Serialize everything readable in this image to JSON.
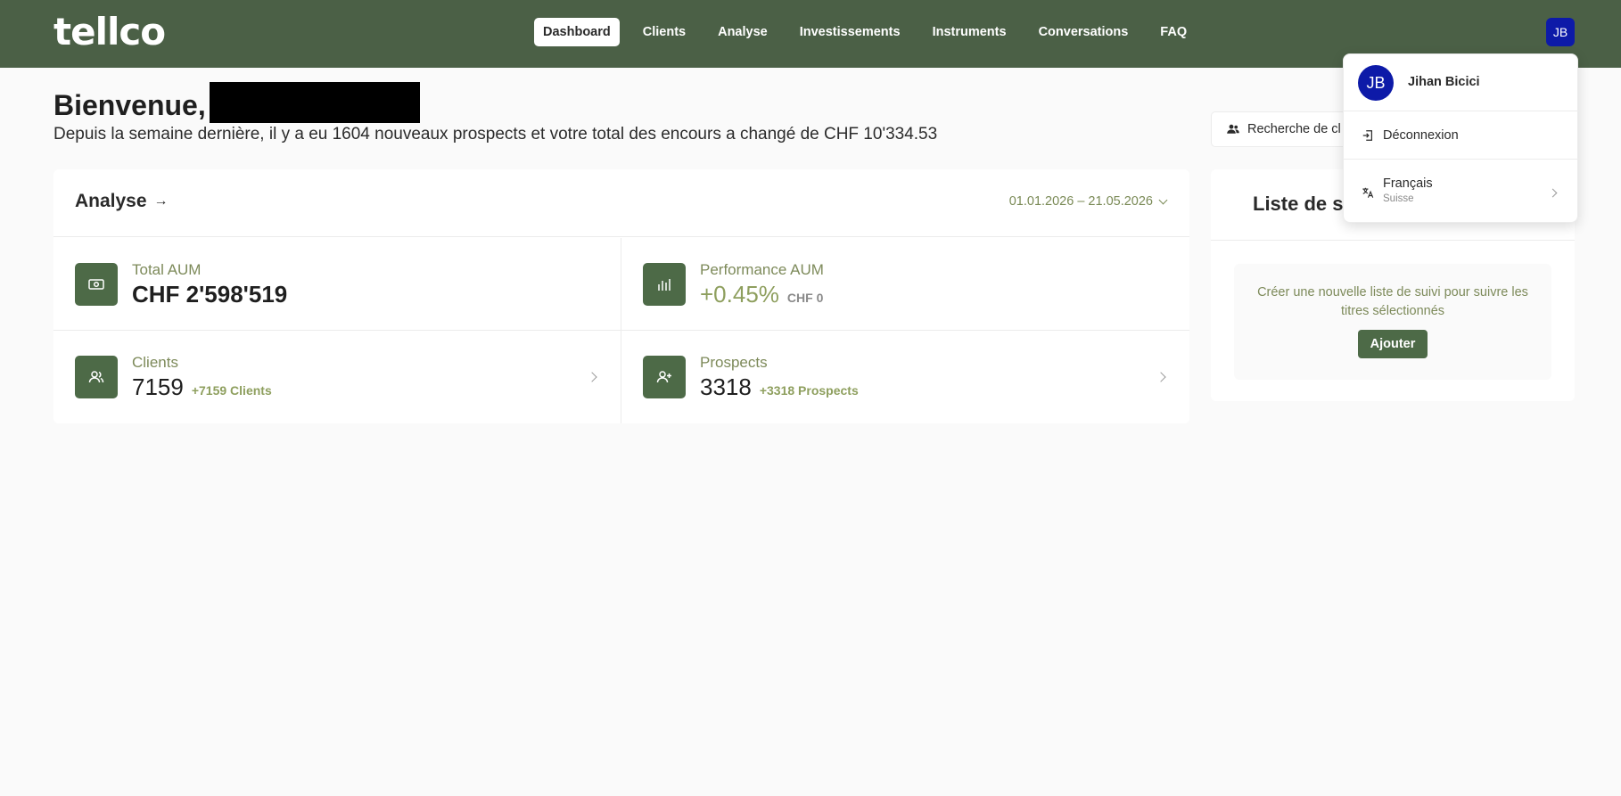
{
  "header": {
    "logo": "tellco",
    "nav": [
      {
        "label": "Dashboard",
        "active": true
      },
      {
        "label": "Clients"
      },
      {
        "label": "Analyse"
      },
      {
        "label": "Investissements"
      },
      {
        "label": "Instruments"
      },
      {
        "label": "Conversations"
      },
      {
        "label": "FAQ"
      }
    ],
    "avatar_initials": "JB",
    "accent_color": "#4b6046",
    "avatar_color": "#0d1aa8"
  },
  "welcome": {
    "title": "Bienvenue,",
    "subtitle": "Depuis la semaine dernière, il y a eu 1604 nouveaux prospects et votre total des encours a changé de CHF 10'334.53"
  },
  "analyse": {
    "title": "Analyse",
    "date_range": "01.01.2026 – 21.05.2026",
    "tiles": [
      {
        "label": "Total AUM",
        "value": "CHF 2'598'519",
        "extra": "",
        "icon": "banknote-icon"
      },
      {
        "label": "Performance AUM",
        "value": "+0.45%",
        "extra": "CHF 0",
        "icon": "bar-chart-icon"
      },
      {
        "label": "Clients",
        "value": "7159",
        "extra": "+7159 Clients",
        "icon": "users-icon"
      },
      {
        "label": "Prospects",
        "value": "3318",
        "extra": "+3318 Prospects",
        "icon": "user-plus-icon"
      }
    ]
  },
  "client_search": {
    "label": "Recherche de cl"
  },
  "watchlist": {
    "title": "Liste de su",
    "empty_text": "Créer une nouvelle liste de suivi pour suivre les titres sélectionnés",
    "add_label": "Ajouter"
  },
  "user_menu": {
    "initials": "JB",
    "name": "Jihan Bicici",
    "logout_label": "Déconnexion",
    "language": "Français",
    "region": "Suisse"
  }
}
